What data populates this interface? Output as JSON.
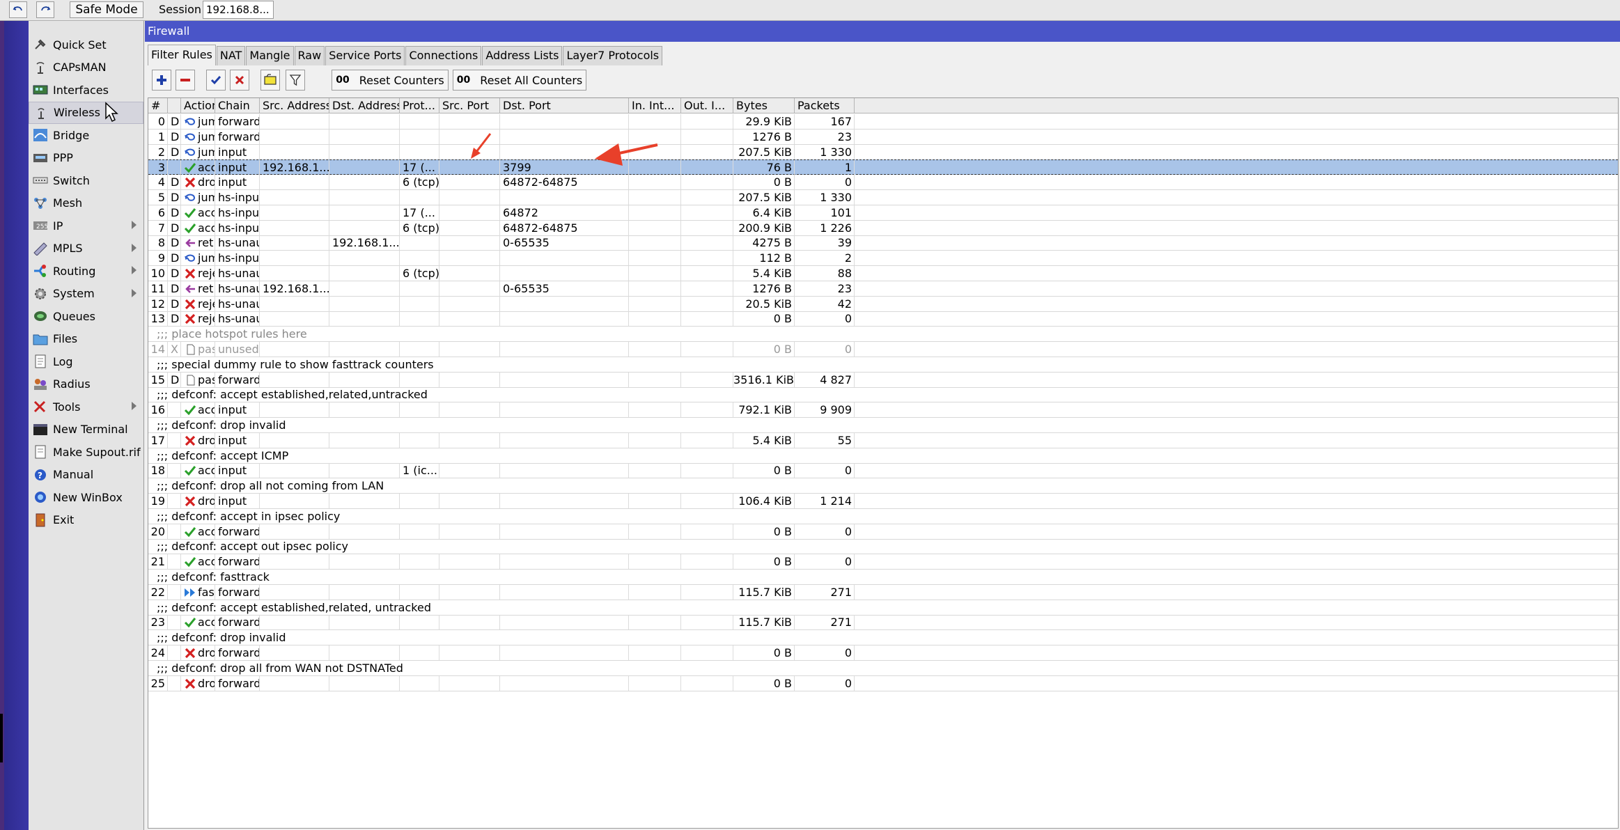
{
  "topbar": {
    "safe_mode_label": "Safe Mode",
    "session_label": "Session",
    "session_value": "192.168.8..."
  },
  "menu": {
    "items": [
      {
        "label": "Quick Set",
        "icon": "quick-set-icon",
        "arrow": false
      },
      {
        "label": "CAPsMAN",
        "icon": "capsman-icon",
        "arrow": false
      },
      {
        "label": "Interfaces",
        "icon": "interfaces-icon",
        "arrow": false
      },
      {
        "label": "Wireless",
        "icon": "wireless-icon",
        "arrow": false,
        "hover": true
      },
      {
        "label": "Bridge",
        "icon": "bridge-icon",
        "arrow": false
      },
      {
        "label": "PPP",
        "icon": "ppp-icon",
        "arrow": false
      },
      {
        "label": "Switch",
        "icon": "switch-icon",
        "arrow": false
      },
      {
        "label": "Mesh",
        "icon": "mesh-icon",
        "arrow": false
      },
      {
        "label": "IP",
        "icon": "ip-icon",
        "arrow": true
      },
      {
        "label": "MPLS",
        "icon": "mpls-icon",
        "arrow": true
      },
      {
        "label": "Routing",
        "icon": "routing-icon",
        "arrow": true
      },
      {
        "label": "System",
        "icon": "system-icon",
        "arrow": true
      },
      {
        "label": "Queues",
        "icon": "queues-icon",
        "arrow": false
      },
      {
        "label": "Files",
        "icon": "files-icon",
        "arrow": false
      },
      {
        "label": "Log",
        "icon": "log-icon",
        "arrow": false
      },
      {
        "label": "Radius",
        "icon": "radius-icon",
        "arrow": false
      },
      {
        "label": "Tools",
        "icon": "tools-icon",
        "arrow": true
      },
      {
        "label": "New Terminal",
        "icon": "terminal-icon",
        "arrow": false
      },
      {
        "label": "Make Supout.rif",
        "icon": "supout-icon",
        "arrow": false
      },
      {
        "label": "Manual",
        "icon": "manual-icon",
        "arrow": false
      },
      {
        "label": "New WinBox",
        "icon": "winbox-icon",
        "arrow": false
      },
      {
        "label": "Exit",
        "icon": "exit-icon",
        "arrow": false
      }
    ]
  },
  "window": {
    "title": "Firewall",
    "tabs": [
      "Filter Rules",
      "NAT",
      "Mangle",
      "Raw",
      "Service Ports",
      "Connections",
      "Address Lists",
      "Layer7 Protocols"
    ],
    "active_tab": 0,
    "reset_counters_label": "Reset Counters",
    "reset_all_counters_label": "Reset All Counters",
    "oo_label": "00"
  },
  "table": {
    "columns": [
      "#",
      "",
      "Action",
      "Chain",
      "Src. Address",
      "Dst. Address",
      "Prot...",
      "Src. Port",
      "Dst. Port",
      "In. Int...",
      "Out. I...",
      "Bytes",
      "Packets"
    ],
    "rows": [
      {
        "type": "rule",
        "num": "0",
        "flag": "D",
        "icon": "jump",
        "action": "jump",
        "chain": "forward",
        "src": "",
        "dst": "",
        "prot": "",
        "sport": "",
        "dport": "",
        "bytes": "29.9 KiB",
        "packets": "167"
      },
      {
        "type": "rule",
        "num": "1",
        "flag": "D",
        "icon": "jump",
        "action": "jump",
        "chain": "forward",
        "src": "",
        "dst": "",
        "prot": "",
        "sport": "",
        "dport": "",
        "bytes": "1276 B",
        "packets": "23"
      },
      {
        "type": "rule",
        "num": "2",
        "flag": "D",
        "icon": "jump",
        "action": "jump",
        "chain": "input",
        "src": "",
        "dst": "",
        "prot": "",
        "sport": "",
        "dport": "",
        "bytes": "207.5 KiB",
        "packets": "1 330"
      },
      {
        "type": "rule",
        "num": "3",
        "flag": "",
        "icon": "accept",
        "action": "acc...",
        "chain": "input",
        "src": "192.168.1...",
        "dst": "",
        "prot": "17 (...",
        "sport": "",
        "dport": "3799",
        "bytes": "76 B",
        "packets": "1",
        "selected": true
      },
      {
        "type": "rule",
        "num": "4",
        "flag": "D",
        "icon": "drop",
        "action": "drop",
        "chain": "input",
        "src": "",
        "dst": "",
        "prot": "6 (tcp)",
        "sport": "",
        "dport": "64872-64875",
        "bytes": "0 B",
        "packets": "0"
      },
      {
        "type": "rule",
        "num": "5",
        "flag": "D",
        "icon": "jump",
        "action": "jump",
        "chain": "hs-input",
        "src": "",
        "dst": "",
        "prot": "",
        "sport": "",
        "dport": "",
        "bytes": "207.5 KiB",
        "packets": "1 330"
      },
      {
        "type": "rule",
        "num": "6",
        "flag": "D",
        "icon": "accept",
        "action": "acc...",
        "chain": "hs-input",
        "src": "",
        "dst": "",
        "prot": "17 (...",
        "sport": "",
        "dport": "64872",
        "bytes": "6.4 KiB",
        "packets": "101"
      },
      {
        "type": "rule",
        "num": "7",
        "flag": "D",
        "icon": "accept",
        "action": "acc...",
        "chain": "hs-input",
        "src": "",
        "dst": "",
        "prot": "6 (tcp)",
        "sport": "",
        "dport": "64872-64875",
        "bytes": "200.9 KiB",
        "packets": "1 226"
      },
      {
        "type": "rule",
        "num": "8",
        "flag": "D",
        "icon": "return",
        "action": "ret...",
        "chain": "hs-unauth",
        "src": "",
        "dst": "192.168.1...",
        "prot": "",
        "sport": "",
        "dport": "0-65535",
        "bytes": "4275 B",
        "packets": "39"
      },
      {
        "type": "rule",
        "num": "9",
        "flag": "D",
        "icon": "jump",
        "action": "jump",
        "chain": "hs-input",
        "src": "",
        "dst": "",
        "prot": "",
        "sport": "",
        "dport": "",
        "bytes": "112 B",
        "packets": "2"
      },
      {
        "type": "rule",
        "num": "10",
        "flag": "D",
        "icon": "drop",
        "action": "reject",
        "chain": "hs-unauth",
        "src": "",
        "dst": "",
        "prot": "6 (tcp)",
        "sport": "",
        "dport": "",
        "bytes": "5.4 KiB",
        "packets": "88"
      },
      {
        "type": "rule",
        "num": "11",
        "flag": "D",
        "icon": "return",
        "action": "ret...",
        "chain": "hs-unaut...",
        "src": "192.168.1...",
        "dst": "",
        "prot": "",
        "sport": "",
        "dport": "0-65535",
        "bytes": "1276 B",
        "packets": "23"
      },
      {
        "type": "rule",
        "num": "12",
        "flag": "D",
        "icon": "drop",
        "action": "reject",
        "chain": "hs-unauth",
        "src": "",
        "dst": "",
        "prot": "",
        "sport": "",
        "dport": "",
        "bytes": "20.5 KiB",
        "packets": "42"
      },
      {
        "type": "rule",
        "num": "13",
        "flag": "D",
        "icon": "drop",
        "action": "reject",
        "chain": "hs-unaut...",
        "src": "",
        "dst": "",
        "prot": "",
        "sport": "",
        "dport": "",
        "bytes": "0 B",
        "packets": "0"
      },
      {
        "type": "comment",
        "text": ";;; place hotspot rules here",
        "grey": true
      },
      {
        "type": "rule",
        "num": "14",
        "flag": "X",
        "icon": "passthrough",
        "action": "pas...",
        "chain": "unused-h...",
        "src": "",
        "dst": "",
        "prot": "",
        "sport": "",
        "dport": "",
        "bytes": "0 B",
        "packets": "0",
        "disabled": true
      },
      {
        "type": "comment",
        "text": ";;; special dummy rule to show fasttrack counters"
      },
      {
        "type": "rule",
        "num": "15",
        "flag": "D",
        "icon": "passthrough",
        "action": "pas...",
        "chain": "forward",
        "src": "",
        "dst": "",
        "prot": "",
        "sport": "",
        "dport": "",
        "bytes": "3516.1 KiB",
        "packets": "4 827"
      },
      {
        "type": "comment",
        "text": ";;; defconf: accept established,related,untracked"
      },
      {
        "type": "rule",
        "num": "16",
        "flag": "",
        "icon": "accept",
        "action": "acc...",
        "chain": "input",
        "src": "",
        "dst": "",
        "prot": "",
        "sport": "",
        "dport": "",
        "bytes": "792.1 KiB",
        "packets": "9 909"
      },
      {
        "type": "comment",
        "text": ";;; defconf: drop invalid"
      },
      {
        "type": "rule",
        "num": "17",
        "flag": "",
        "icon": "drop",
        "action": "drop",
        "chain": "input",
        "src": "",
        "dst": "",
        "prot": "",
        "sport": "",
        "dport": "",
        "bytes": "5.4 KiB",
        "packets": "55"
      },
      {
        "type": "comment",
        "text": ";;; defconf: accept ICMP"
      },
      {
        "type": "rule",
        "num": "18",
        "flag": "",
        "icon": "accept",
        "action": "acc...",
        "chain": "input",
        "src": "",
        "dst": "",
        "prot": "1 (ic...",
        "sport": "",
        "dport": "",
        "bytes": "0 B",
        "packets": "0"
      },
      {
        "type": "comment",
        "text": ";;; defconf: drop all not coming from LAN"
      },
      {
        "type": "rule",
        "num": "19",
        "flag": "",
        "icon": "drop",
        "action": "drop",
        "chain": "input",
        "src": "",
        "dst": "",
        "prot": "",
        "sport": "",
        "dport": "",
        "bytes": "106.4 KiB",
        "packets": "1 214"
      },
      {
        "type": "comment",
        "text": ";;; defconf: accept in ipsec policy"
      },
      {
        "type": "rule",
        "num": "20",
        "flag": "",
        "icon": "accept",
        "action": "acc...",
        "chain": "forward",
        "src": "",
        "dst": "",
        "prot": "",
        "sport": "",
        "dport": "",
        "bytes": "0 B",
        "packets": "0"
      },
      {
        "type": "comment",
        "text": ";;; defconf: accept out ipsec policy"
      },
      {
        "type": "rule",
        "num": "21",
        "flag": "",
        "icon": "accept",
        "action": "acc...",
        "chain": "forward",
        "src": "",
        "dst": "",
        "prot": "",
        "sport": "",
        "dport": "",
        "bytes": "0 B",
        "packets": "0"
      },
      {
        "type": "comment",
        "text": ";;; defconf: fasttrack"
      },
      {
        "type": "rule",
        "num": "22",
        "flag": "",
        "icon": "fasttrack",
        "action": "fas...",
        "chain": "forward",
        "src": "",
        "dst": "",
        "prot": "",
        "sport": "",
        "dport": "",
        "bytes": "115.7 KiB",
        "packets": "271"
      },
      {
        "type": "comment",
        "text": ";;; defconf: accept established,related, untracked"
      },
      {
        "type": "rule",
        "num": "23",
        "flag": "",
        "icon": "accept",
        "action": "acc...",
        "chain": "forward",
        "src": "",
        "dst": "",
        "prot": "",
        "sport": "",
        "dport": "",
        "bytes": "115.7 KiB",
        "packets": "271"
      },
      {
        "type": "comment",
        "text": ";;; defconf: drop invalid"
      },
      {
        "type": "rule",
        "num": "24",
        "flag": "",
        "icon": "drop",
        "action": "drop",
        "chain": "forward",
        "src": "",
        "dst": "",
        "prot": "",
        "sport": "",
        "dport": "",
        "bytes": "0 B",
        "packets": "0"
      },
      {
        "type": "comment",
        "text": ";;; defconf:  drop all from WAN not DSTNATed"
      },
      {
        "type": "rule",
        "num": "25",
        "flag": "",
        "icon": "drop",
        "action": "drop",
        "chain": "forward",
        "src": "",
        "dst": "",
        "prot": "",
        "sport": "",
        "dport": "",
        "bytes": "0 B",
        "packets": "0"
      }
    ]
  },
  "colors": {
    "title_bar": "#4a55c8",
    "selected_row": "#a9c4e8",
    "annotation_arrow": "#e8402a",
    "accept": "#2aa02a",
    "drop": "#d42020"
  }
}
